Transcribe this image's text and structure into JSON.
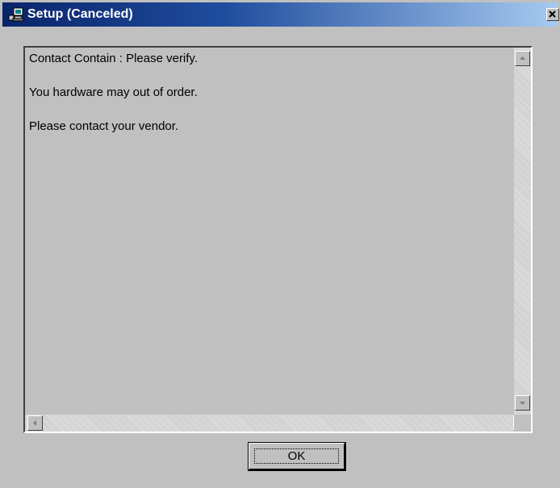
{
  "window": {
    "title": "Setup (Canceled)",
    "icon": "setup-computer-icon",
    "close_icon": "close-icon",
    "title_bar_color": "#0a246a"
  },
  "message": {
    "lines": [
      "Contact Contain : Please verify.",
      "You hardware may out of order.",
      "Please contact your vendor."
    ]
  },
  "scrollbars": {
    "up_icon": "scroll-up-arrow-icon",
    "down_icon": "scroll-down-arrow-icon",
    "left_icon": "scroll-left-arrow-icon",
    "right_icon": "scroll-right-arrow-icon"
  },
  "buttons": {
    "ok_label": "OK"
  }
}
